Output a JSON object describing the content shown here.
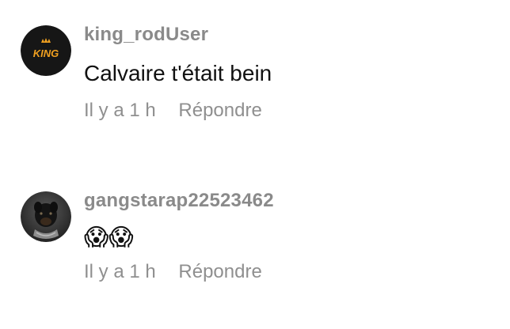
{
  "comments": [
    {
      "username": "king_rodUser",
      "text": "Calvaire t'était bein",
      "time": "Il y a 1 h",
      "reply_label": "Répondre",
      "avatar_logo_text": "KING"
    },
    {
      "username": "gangstarap22523462",
      "text": "😱😱",
      "time": "Il y a 1 h",
      "reply_label": "Répondre"
    }
  ],
  "colors": {
    "username": "#8a8a8a",
    "text": "#111111",
    "meta": "#8f8f8f",
    "king_avatar_bg": "#161616",
    "king_logo": "#f0a020"
  }
}
